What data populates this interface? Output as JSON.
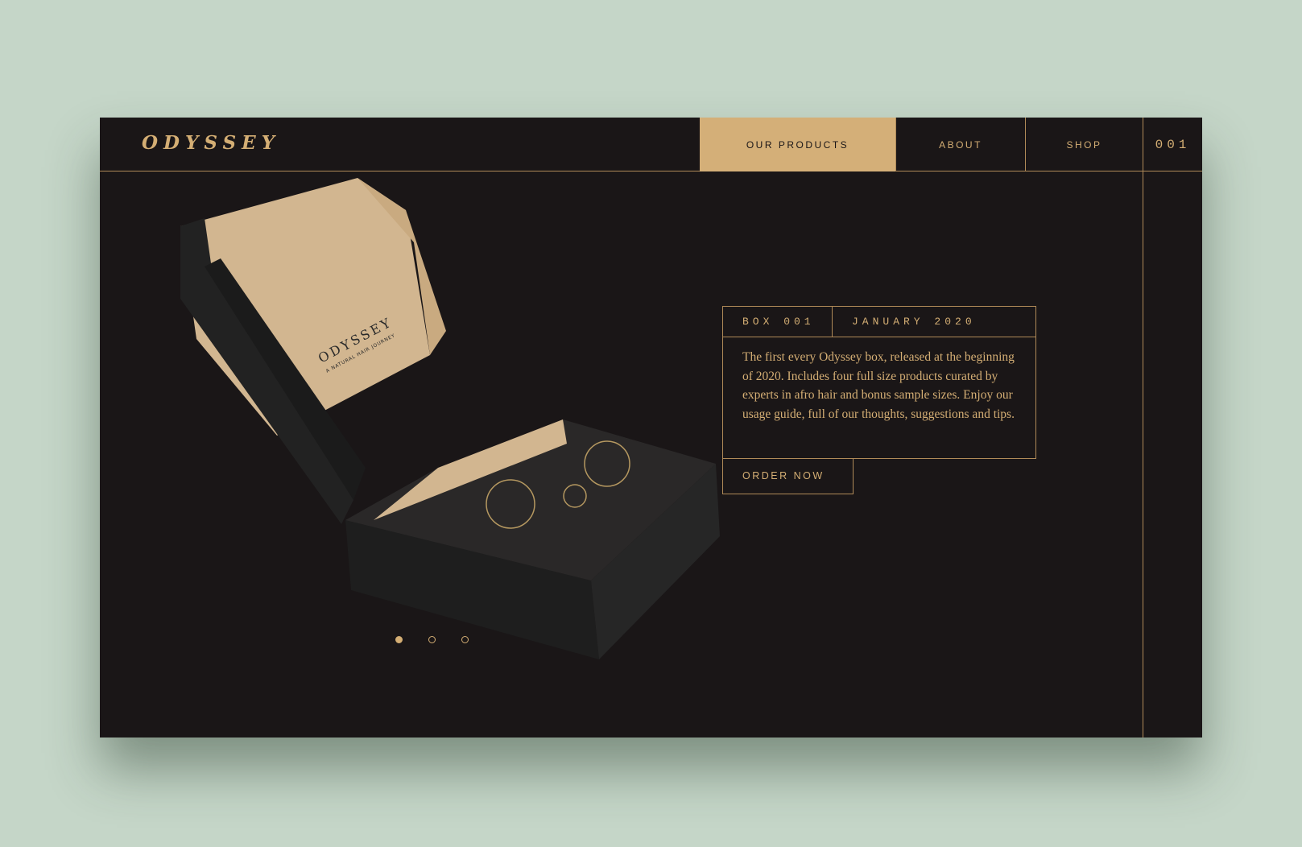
{
  "header": {
    "logo": "ODYSSEY",
    "nav": [
      {
        "label": "OUR PRODUCTS",
        "active": true
      },
      {
        "label": "ABOUT"
      },
      {
        "label": "SHOP"
      }
    ],
    "counter": "001"
  },
  "product": {
    "box_label": "BOX 001",
    "date": "JANUARY 2020",
    "description": "The first every Odyssey box, released at the beginning of 2020. Includes four full size products curated by experts in afro hair and bonus sample sizes. Enjoy our usage guide, full of our thoughts, suggestions and tips.",
    "order_label": "ORDER NOW",
    "box_print_logo": "ODYSSEY",
    "box_print_tagline": "A NATURAL HAIR JOURNEY"
  },
  "carousel": {
    "count": 3,
    "active": 0
  },
  "colors": {
    "gold": "#d4ae74",
    "background": "#1a1617",
    "page": "#c5d6c8"
  }
}
